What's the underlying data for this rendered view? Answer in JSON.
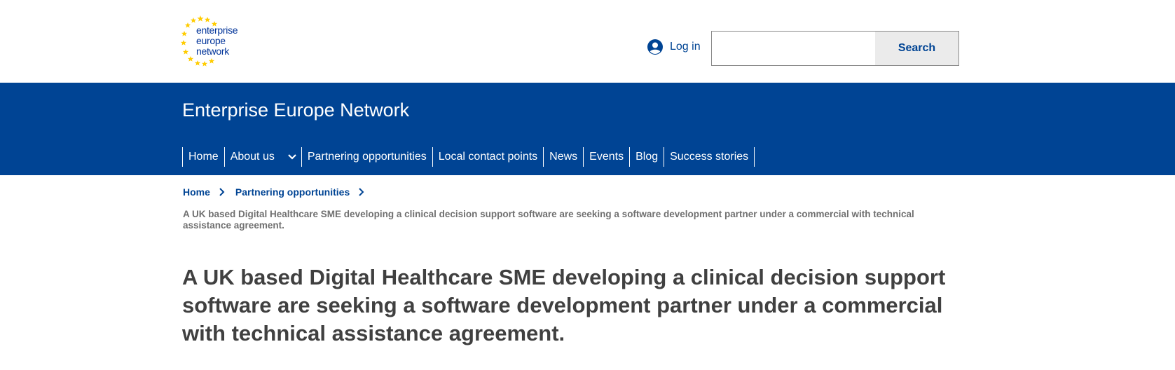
{
  "header": {
    "logo": {
      "line1": "enterprise",
      "line2": "europe",
      "line3": "network",
      "star_color": "#ffcc00",
      "text_color": "#003399"
    },
    "login_label": "Log in",
    "login_icon": "user-circle-icon",
    "search": {
      "value": "",
      "placeholder": "",
      "button_label": "Search"
    }
  },
  "banner": {
    "background": "#004494",
    "site_title": "Enterprise Europe Network",
    "nav": {
      "home": "Home",
      "about": "About us",
      "partnering": "Partnering opportunities",
      "local": "Local contact points",
      "news": "News",
      "events": "Events",
      "blog": "Blog",
      "success": "Success stories"
    }
  },
  "breadcrumb": {
    "home": "Home",
    "partnering": "Partnering opportunities",
    "current": "A UK based Digital Healthcare SME developing a clinical decision support software are seeking a software development partner under a commercial with technical assistance agreement."
  },
  "page": {
    "title": "A UK based Digital Healthcare SME developing a clinical decision support software are seeking a software development partner under a commercial with technical assistance agreement."
  }
}
